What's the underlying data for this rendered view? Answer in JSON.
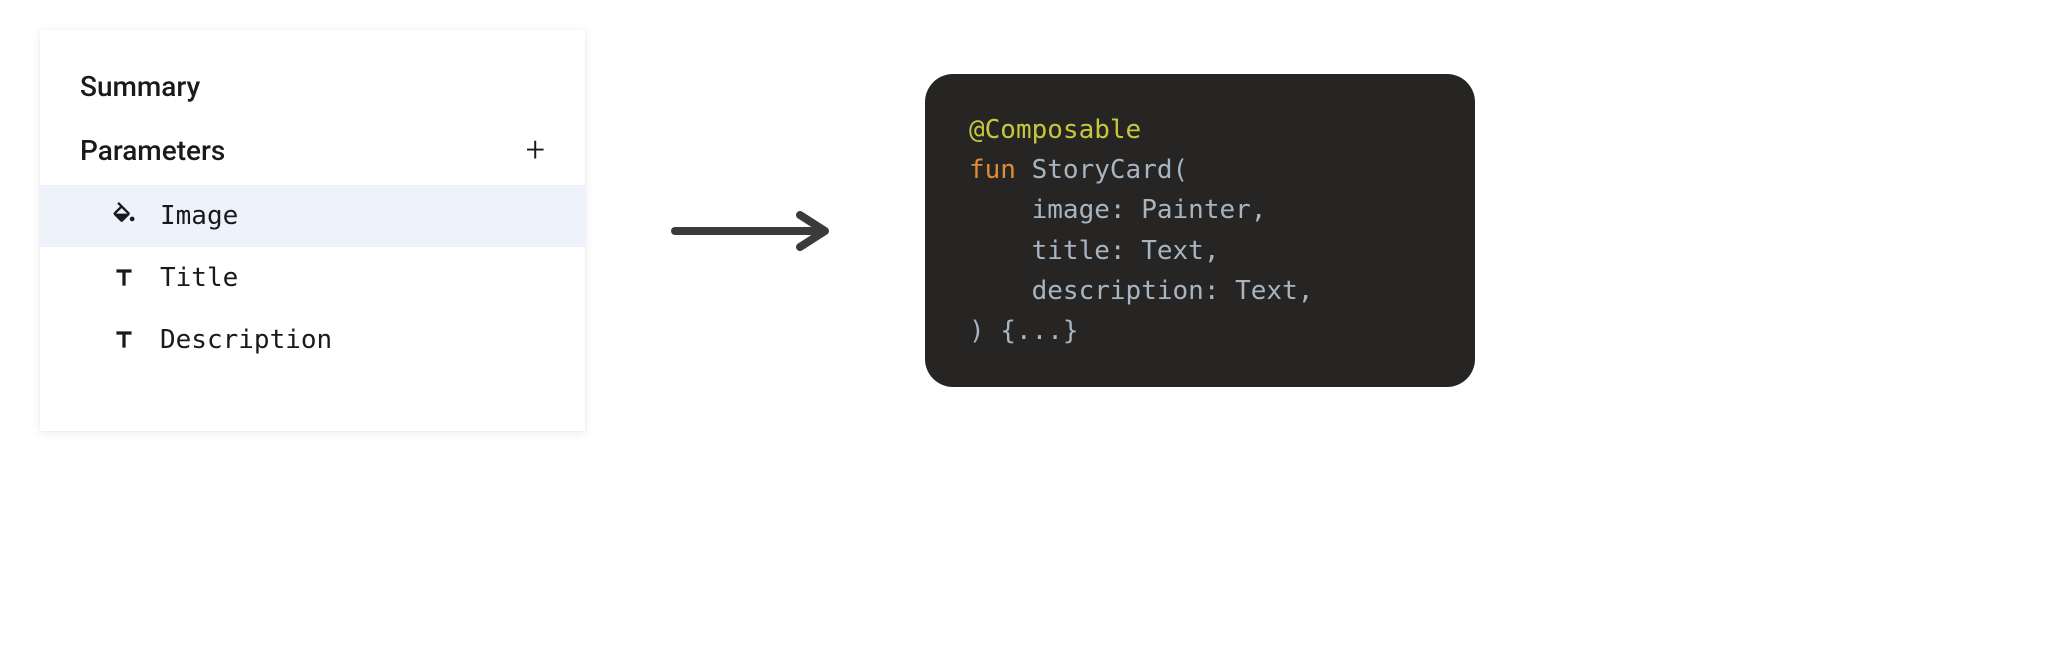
{
  "panel": {
    "summary_label": "Summary",
    "parameters_label": "Parameters",
    "params": [
      {
        "name": "Image",
        "icon": "fill",
        "selected": true
      },
      {
        "name": "Title",
        "icon": "text",
        "selected": false
      },
      {
        "name": "Description",
        "icon": "text",
        "selected": false
      }
    ]
  },
  "code": {
    "annotation": "@Composable",
    "keyword_fun": "fun",
    "function_name": "StoryCard",
    "open_paren": "(",
    "params": [
      {
        "name": "image",
        "type": "Painter"
      },
      {
        "name": "title",
        "type": "Text"
      },
      {
        "name": "description",
        "type": "Text"
      }
    ],
    "close": ") {...}"
  }
}
